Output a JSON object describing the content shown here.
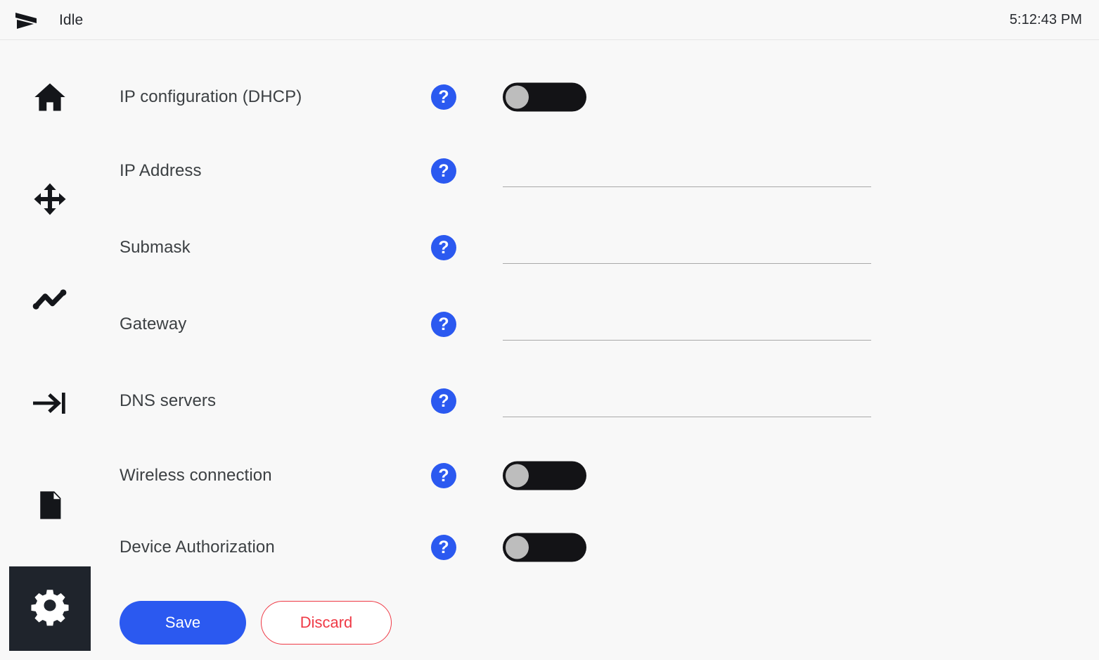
{
  "header": {
    "logo_icon": "send-arrow-logo",
    "status": "Idle",
    "time": "5:12:43 PM"
  },
  "sidebar": {
    "items": [
      {
        "icon": "home-icon",
        "name": "home",
        "selected": false
      },
      {
        "icon": "move-arrows-icon",
        "name": "movement",
        "selected": false
      },
      {
        "icon": "line-chart-icon",
        "name": "chart",
        "selected": false
      },
      {
        "icon": "arrow-to-line-icon",
        "name": "jog",
        "selected": false
      },
      {
        "icon": "document-icon",
        "name": "files",
        "selected": false
      },
      {
        "icon": "gear-icon",
        "name": "settings",
        "selected": true
      }
    ]
  },
  "settings": {
    "rows": [
      {
        "label": "IP configuration (DHCP)",
        "control": "toggle",
        "value": "off",
        "help": "?"
      },
      {
        "label": "IP Address",
        "control": "input",
        "value": "",
        "placeholder": "",
        "help": "?"
      },
      {
        "label": "Submask",
        "control": "input",
        "value": "",
        "placeholder": "",
        "help": "?"
      },
      {
        "label": "Gateway",
        "control": "input",
        "value": "",
        "placeholder": "",
        "help": "?"
      },
      {
        "label": "DNS servers",
        "control": "input",
        "value": "",
        "placeholder": "",
        "help": "?"
      },
      {
        "label": "Wireless connection",
        "control": "toggle",
        "value": "off",
        "help": "?"
      },
      {
        "label": "Device Authorization",
        "control": "toggle",
        "value": "off",
        "help": "?"
      }
    ],
    "save_label": "Save",
    "discard_label": "Discard"
  },
  "colors": {
    "accent_blue": "#2b59f0",
    "danger_red": "#ef3a46",
    "toggle_track": "#131316",
    "toggle_knob": "#bdbdbd",
    "sidebar_selected": "#1f242c",
    "page_bg": "#f8f8f8"
  }
}
